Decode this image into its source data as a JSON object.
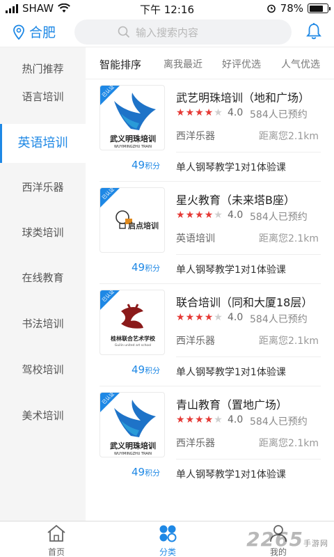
{
  "status_bar": {
    "carrier": "SHAW",
    "time": "下午 12:16",
    "battery": "78%",
    "battery_level": 0.78
  },
  "header": {
    "city": "合肥",
    "search_placeholder": "输入搜索内容",
    "icons": [
      "location-pin-icon",
      "search-icon",
      "bell-icon"
    ]
  },
  "sidebar": {
    "items": [
      {
        "label": "热门推荐",
        "active": false
      },
      {
        "label": "语言培训",
        "active": false
      },
      {
        "label": "英语培训",
        "active": true
      },
      {
        "label": "西洋乐器",
        "active": false
      },
      {
        "label": "球类培训",
        "active": false
      },
      {
        "label": "在线教育",
        "active": false
      },
      {
        "label": "书法培训",
        "active": false
      },
      {
        "label": "驾校培训",
        "active": false
      },
      {
        "label": "美术培训",
        "active": false
      }
    ]
  },
  "sort_tabs": [
    {
      "label": "智能排序",
      "active": true
    },
    {
      "label": "离我最近",
      "active": false
    },
    {
      "label": "好评优选",
      "active": false
    },
    {
      "label": "人气优选",
      "active": false
    }
  ],
  "listings": [
    {
      "name": "武艺明珠培训（地和广场）",
      "badge": "已认证",
      "logo_text": "武义明珠培训",
      "logo_sub": "WUYIMINGZHU TRAIN",
      "stars_filled": 4,
      "rating": "4.0",
      "appointments": "584人已预约",
      "category": "西洋乐器",
      "distance": "距离您2.1km",
      "points": "49",
      "points_unit": "积分",
      "course": "单人钢琴教学1对1体验课"
    },
    {
      "name": "星火教育（未来塔B座）",
      "badge": "已认证",
      "logo_text": "启点培训",
      "logo_sub": "",
      "stars_filled": 4,
      "rating": "4.0",
      "appointments": "584人已预约",
      "category": "英语培训",
      "distance": "距离您2.1km",
      "points": "49",
      "points_unit": "积分",
      "course": "单人钢琴教学1对1体验课"
    },
    {
      "name": "联合培训（同和大厦18层）",
      "badge": "已认证",
      "logo_text": "桂林联合艺术学校",
      "logo_sub": "Guilin united art school",
      "stars_filled": 4,
      "rating": "4.0",
      "appointments": "584人已预约",
      "category": "西洋乐器",
      "distance": "距离您2.1km",
      "points": "49",
      "points_unit": "积分",
      "course": "单人钢琴教学1对1体验课"
    },
    {
      "name": "青山教育（置地广场）",
      "badge": "已认证",
      "logo_text": "武义明珠培训",
      "logo_sub": "WUYIMINGZHU TRAIN",
      "stars_filled": 4,
      "rating": "4.0",
      "appointments": "584人已预约",
      "category": "西洋乐器",
      "distance": "距离您2.1km",
      "points": "49",
      "points_unit": "积分",
      "course": "单人钢琴教学1对1体验课"
    }
  ],
  "bottom_nav": [
    {
      "label": "首页",
      "icon": "home-icon",
      "active": false
    },
    {
      "label": "分类",
      "icon": "category-icon",
      "active": true
    },
    {
      "label": "我的",
      "icon": "profile-icon",
      "active": false
    }
  ],
  "watermark": {
    "text": "2265",
    "sub": "手游网"
  },
  "colors": {
    "accent": "#1e88e5",
    "star": "#e53935",
    "sidebar_bg": "#f5f5f5"
  }
}
